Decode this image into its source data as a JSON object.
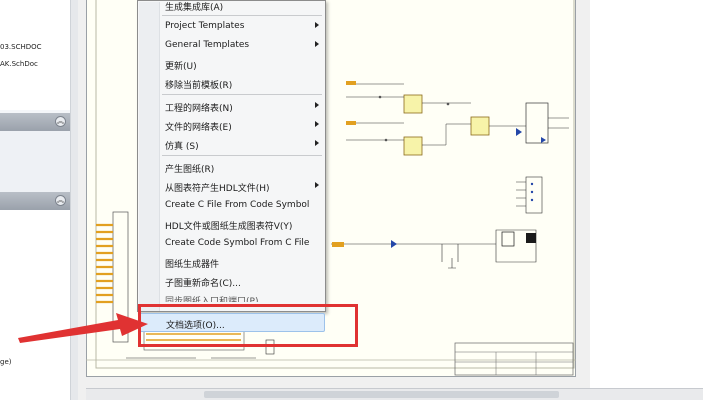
{
  "left_panel": {
    "files": [
      "03.SCHDOC",
      "AK.SchDoc"
    ],
    "cut_text": "ge)"
  },
  "menu": {
    "items": [
      {
        "label": "生成集成库(A)",
        "submenu": false
      },
      {
        "label": "Project Templates",
        "submenu": true
      },
      {
        "label": "General Templates",
        "submenu": true
      },
      {
        "label": "更新(U)",
        "submenu": false
      },
      {
        "label": "移除当前模板(R)",
        "submenu": false
      },
      {
        "label": "工程的网络表(N)",
        "submenu": true
      },
      {
        "label": "文件的网络表(E)",
        "submenu": true
      },
      {
        "label": "仿真 (S)",
        "submenu": true
      },
      {
        "label": "产生图纸(R)",
        "submenu": false
      },
      {
        "label": "从图表符产生HDL文件(H)",
        "submenu": true
      },
      {
        "label": "Create C File From Code Symbol",
        "submenu": false
      },
      {
        "label": "HDL文件或图纸生成图表符V(Y)",
        "submenu": false
      },
      {
        "label": "Create Code Symbol From C File",
        "submenu": false
      },
      {
        "label": "图纸生成器件",
        "submenu": false
      },
      {
        "label": "子图重新命名(C)...",
        "submenu": false
      },
      {
        "label": "同步图纸入口和端口(P)",
        "submenu": false
      },
      {
        "label": "文档选项(O)...",
        "submenu": false
      }
    ]
  },
  "colors": {
    "annotation": "#e03232",
    "menu_highlight": "#dcebfb",
    "sheet": "#fffff6"
  }
}
